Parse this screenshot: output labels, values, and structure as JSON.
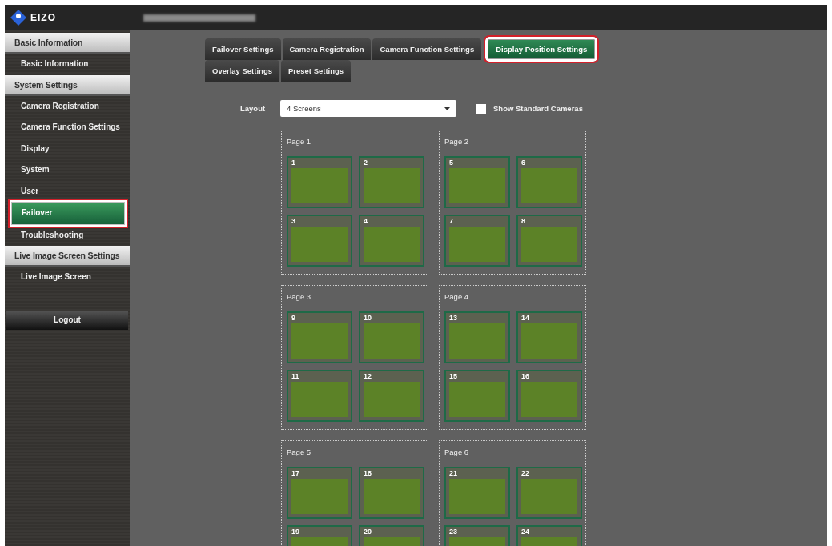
{
  "header": {
    "logo": "EIZO",
    "title_blurred": true
  },
  "sidebar": [
    {
      "kind": "section",
      "label": "Basic Information"
    },
    {
      "kind": "item",
      "label": "Basic Information",
      "selected": false,
      "highlighted": false
    },
    {
      "kind": "section",
      "label": "System Settings"
    },
    {
      "kind": "item",
      "label": "Camera Registration",
      "selected": false,
      "highlighted": false
    },
    {
      "kind": "item",
      "label": "Camera Function Settings",
      "selected": false,
      "highlighted": false
    },
    {
      "kind": "item",
      "label": "Display",
      "selected": false,
      "highlighted": false
    },
    {
      "kind": "item",
      "label": "System",
      "selected": false,
      "highlighted": false
    },
    {
      "kind": "item",
      "label": "User",
      "selected": false,
      "highlighted": false
    },
    {
      "kind": "item",
      "label": "Failover",
      "selected": true,
      "highlighted": true
    },
    {
      "kind": "item",
      "label": "Troubleshooting",
      "selected": false,
      "highlighted": false
    },
    {
      "kind": "section",
      "label": "Live Image Screen Settings"
    },
    {
      "kind": "item",
      "label": "Live Image Screen",
      "selected": false,
      "highlighted": false
    },
    {
      "kind": "gap"
    },
    {
      "kind": "button",
      "label": "Logout"
    }
  ],
  "tab_rows": [
    [
      {
        "label": "Failover Settings",
        "selected": false,
        "highlighted": false
      },
      {
        "label": "Camera Registration",
        "selected": false,
        "highlighted": false
      },
      {
        "label": "Camera Function Settings",
        "selected": false,
        "highlighted": false
      },
      {
        "label": "Display Position Settings",
        "selected": true,
        "highlighted": true
      }
    ],
    [
      {
        "label": "Overlay Settings",
        "selected": false,
        "highlighted": false
      },
      {
        "label": "Preset Settings",
        "selected": false,
        "highlighted": false
      }
    ]
  ],
  "layout": {
    "label": "Layout",
    "value": "4 Screens"
  },
  "show_standard_cameras": {
    "label": "Show Standard Cameras",
    "checked": false
  },
  "pages": [
    {
      "title": "Page 1",
      "screens": [
        "1",
        "2",
        "3",
        "4"
      ]
    },
    {
      "title": "Page 2",
      "screens": [
        "5",
        "6",
        "7",
        "8"
      ]
    },
    {
      "title": "Page 3",
      "screens": [
        "9",
        "10",
        "11",
        "12"
      ]
    },
    {
      "title": "Page 4",
      "screens": [
        "13",
        "14",
        "15",
        "16"
      ]
    },
    {
      "title": "Page 5",
      "screens": [
        "17",
        "18",
        "19",
        "20"
      ]
    },
    {
      "title": "Page 6",
      "screens": [
        "21",
        "22",
        "23",
        "24"
      ]
    }
  ]
}
